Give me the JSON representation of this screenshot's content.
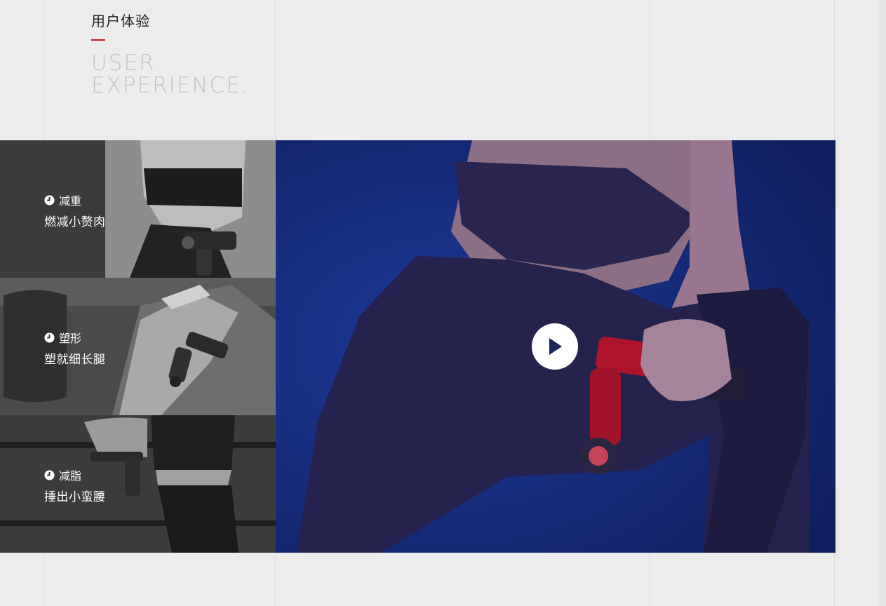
{
  "header": {
    "title_zh": "用户体验",
    "title_en_line1": "USER",
    "title_en_line2": "EXPERIENCE."
  },
  "panels": [
    {
      "icon": "clock-icon",
      "title": "减重",
      "subtitle": "燃减小赘肉"
    },
    {
      "icon": "clock-icon",
      "title": "塑形",
      "subtitle": "塑就细长腿"
    },
    {
      "icon": "clock-icon",
      "title": "减脂",
      "subtitle": "捶出小蛮腰"
    }
  ],
  "video": {
    "icon": "play-icon"
  },
  "colors": {
    "accent": "#c8161d",
    "video_bg": "#14286e",
    "panel_bg": "#3a3a3a"
  }
}
